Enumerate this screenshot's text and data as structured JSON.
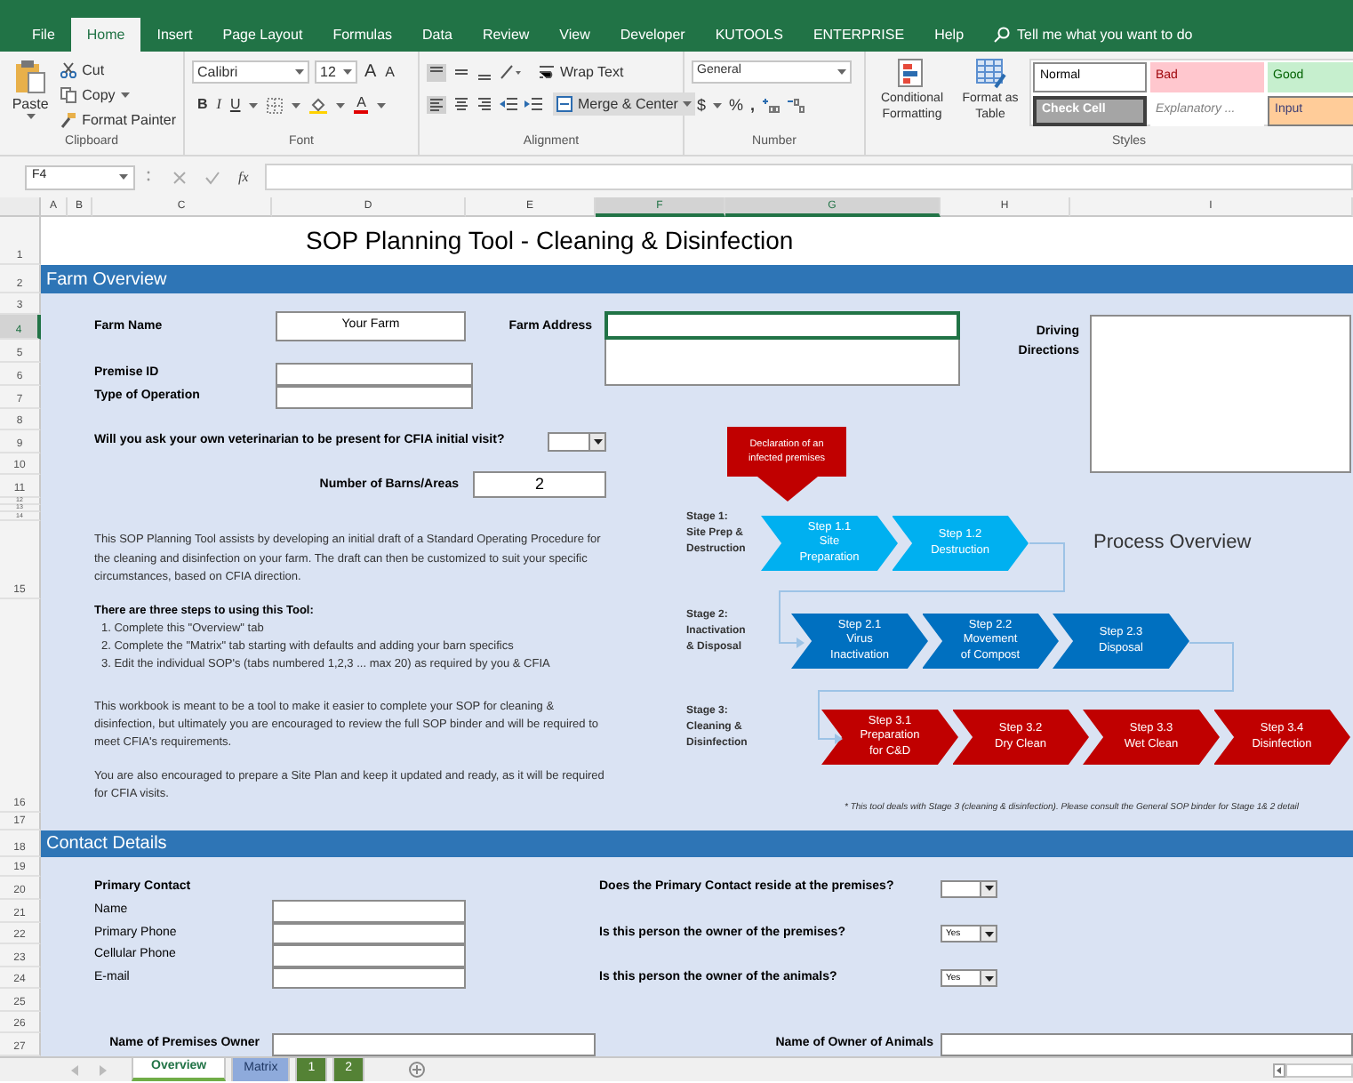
{
  "ribbon_tabs": [
    {
      "label": "File",
      "selected": false
    },
    {
      "label": "Home",
      "selected": true
    },
    {
      "label": "Insert",
      "selected": false
    },
    {
      "label": "Page Layout",
      "selected": false
    },
    {
      "label": "Formulas",
      "selected": false
    },
    {
      "label": "Data",
      "selected": false
    },
    {
      "label": "Review",
      "selected": false
    },
    {
      "label": "View",
      "selected": false
    },
    {
      "label": "Developer",
      "selected": false
    },
    {
      "label": "KUTOOLS",
      "selected": false
    },
    {
      "label": "ENTERPRISE",
      "selected": false
    },
    {
      "label": "Help",
      "selected": false
    }
  ],
  "tell_me": "Tell me what you want to do",
  "ribbon": {
    "clipboard": {
      "paste": "Paste",
      "cut": "Cut",
      "copy": "Copy",
      "format_painter": "Format Painter",
      "label": "Clipboard"
    },
    "font": {
      "name": "Calibri",
      "size": "12",
      "grow": "A",
      "shrink": "A",
      "bold": "B",
      "italic": "I",
      "underline": "U",
      "font_color": "A",
      "label": "Font"
    },
    "alignment": {
      "wrap_text": "Wrap Text",
      "merge": "Merge & Center",
      "label": "Alignment"
    },
    "number": {
      "format": "General",
      "currency": "$",
      "percent": "%",
      "comma": ",",
      "label": "Number"
    },
    "styles": {
      "conditional": "Conditional Formatting",
      "format_table": "Format as Table",
      "label": "Styles",
      "cells": [
        {
          "label": "Normal",
          "kind": "normal"
        },
        {
          "label": "Bad",
          "kind": "bad"
        },
        {
          "label": "Good",
          "kind": "good"
        },
        {
          "label": "Check Cell",
          "kind": "check"
        },
        {
          "label": "Explanatory ...",
          "kind": "explanatory"
        },
        {
          "label": "Input",
          "kind": "input"
        }
      ]
    }
  },
  "formula_bar": {
    "name_box": "F4",
    "function_label": "fx"
  },
  "columns": [
    {
      "label": "A",
      "selected": false
    },
    {
      "label": "B",
      "selected": false
    },
    {
      "label": "C",
      "selected": false
    },
    {
      "label": "D",
      "selected": false
    },
    {
      "label": "E",
      "selected": false
    },
    {
      "label": "F",
      "selected": true
    },
    {
      "label": "G",
      "selected": true
    },
    {
      "label": "H",
      "selected": false
    },
    {
      "label": "I",
      "selected": false
    }
  ],
  "rows": [
    {
      "label": "1",
      "selected": false
    },
    {
      "label": "2",
      "selected": false
    },
    {
      "label": "3",
      "selected": false
    },
    {
      "label": "4",
      "selected": true
    },
    {
      "label": "5",
      "selected": false
    },
    {
      "label": "6",
      "selected": false
    },
    {
      "label": "7",
      "selected": false
    },
    {
      "label": "8",
      "selected": false
    },
    {
      "label": "9",
      "selected": false
    },
    {
      "label": "10",
      "selected": false
    },
    {
      "label": "11",
      "selected": false
    },
    {
      "label": "12",
      "selected": false
    },
    {
      "label": "13",
      "selected": false
    },
    {
      "label": "14",
      "selected": false
    },
    {
      "label": "15",
      "selected": false
    },
    {
      "label": "16",
      "selected": false
    },
    {
      "label": "17",
      "selected": false
    },
    {
      "label": "18",
      "selected": false
    },
    {
      "label": "19",
      "selected": false
    },
    {
      "label": "20",
      "selected": false
    },
    {
      "label": "21",
      "selected": false
    },
    {
      "label": "22",
      "selected": false
    },
    {
      "label": "23",
      "selected": false
    },
    {
      "label": "24",
      "selected": false
    },
    {
      "label": "25",
      "selected": false
    },
    {
      "label": "26",
      "selected": false
    },
    {
      "label": "27",
      "selected": false
    }
  ],
  "sheet_title": "SOP Planning Tool - Cleaning & Disinfection",
  "farm_overview": {
    "title": "Farm Overview",
    "farm_name": {
      "label": "Farm Name",
      "value": "Your Farm"
    },
    "farm_address": {
      "label": "Farm Address",
      "selected": true
    },
    "driving_directions": {
      "label": "Driving Directions"
    },
    "premise_id": {
      "label": "Premise ID"
    },
    "type_of_operation": {
      "label": "Type of Operation"
    },
    "vet_question": "Will you ask your own veterinarian to be present for CFIA initial visit?",
    "barns": {
      "label": "Number of Barns/Areas",
      "value": "2"
    },
    "intro": "This SOP Planning Tool assists by developing an initial draft of a Standard Operating Procedure for the cleaning and disinfection on your farm. The draft can then be customized to suit your specific circumstances, based on CFIA direction.",
    "steps_heading": "There are three steps to using this Tool:",
    "steps": [
      "1. Complete this \"Overview\" tab",
      "2. Complete the \"Matrix\" tab starting with defaults and adding your barn specifics",
      "3. Edit the individual SOP's (tabs numbered 1,2,3 ... max 20) as required by you & CFIA"
    ],
    "notes": [
      "This workbook is meant to be a tool to make it easier to complete your SOP for cleaning & disinfection, but ultimately you are encouraged to review the full SOP binder and will be required to meet CFIA's requirements.",
      "You are also encouraged to prepare a Site Plan and keep it updated and ready, as it will be required for CFIA visits."
    ]
  },
  "diagram": {
    "declaration": "Declaration of an infected premises",
    "title": "Process Overview",
    "stages": [
      {
        "label_lines": [
          "Stage 1:",
          "Site Prep &",
          "Destruction"
        ],
        "color": "#00b0f0",
        "steps": [
          {
            "lines": [
              "Step 1.1",
              "Site",
              "Preparation"
            ]
          },
          {
            "lines": [
              "Step 1.2",
              "Destruction"
            ]
          }
        ]
      },
      {
        "label_lines": [
          "Stage 2:",
          "Inactivation",
          "& Disposal"
        ],
        "color": "#0070c0",
        "steps": [
          {
            "lines": [
              "Step 2.1",
              "Virus",
              "Inactivation"
            ]
          },
          {
            "lines": [
              "Step 2.2",
              "Movement",
              "of Compost"
            ]
          },
          {
            "lines": [
              "Step 2.3",
              "Disposal"
            ]
          }
        ]
      },
      {
        "label_lines": [
          "Stage 3:",
          "Cleaning &",
          "Disinfection"
        ],
        "color": "#c00000",
        "steps": [
          {
            "lines": [
              "Step 3.1",
              "Preparation",
              "for C&D"
            ]
          },
          {
            "lines": [
              "Step 3.2",
              "Dry Clean"
            ]
          },
          {
            "lines": [
              "Step 3.3",
              "Wet Clean"
            ]
          },
          {
            "lines": [
              "Step 3.4",
              "Disinfection"
            ]
          }
        ]
      }
    ],
    "footnote": "* This tool deals with Stage 3 (cleaning & disinfection). Please consult the General SOP binder for Stage 1& 2 detail"
  },
  "contact": {
    "title": "Contact Details",
    "primary_contact": "Primary Contact",
    "fields": [
      {
        "label": "Name"
      },
      {
        "label": "Primary Phone"
      },
      {
        "label": "Cellular Phone"
      },
      {
        "label": "E-mail"
      }
    ],
    "questions": [
      {
        "question": "Does the Primary Contact reside at the premises?"
      },
      {
        "question": "Is this person the owner of the premises?",
        "answer": "Yes"
      },
      {
        "question": "Is this person the owner of the animals?",
        "answer": "Yes"
      }
    ],
    "premises_owner": {
      "label": "Name of Premises Owner"
    },
    "animals_owner": {
      "label": "Name of Owner of Animals"
    }
  },
  "sheet_tabs": [
    {
      "label": "Overview",
      "selected": true,
      "color": "#70ad47"
    },
    {
      "label": "Matrix",
      "selected": false,
      "color": "#8eaadb"
    },
    {
      "label": "1",
      "selected": false,
      "color": "#548235"
    },
    {
      "label": "2",
      "selected": false,
      "color": "#548235"
    }
  ]
}
